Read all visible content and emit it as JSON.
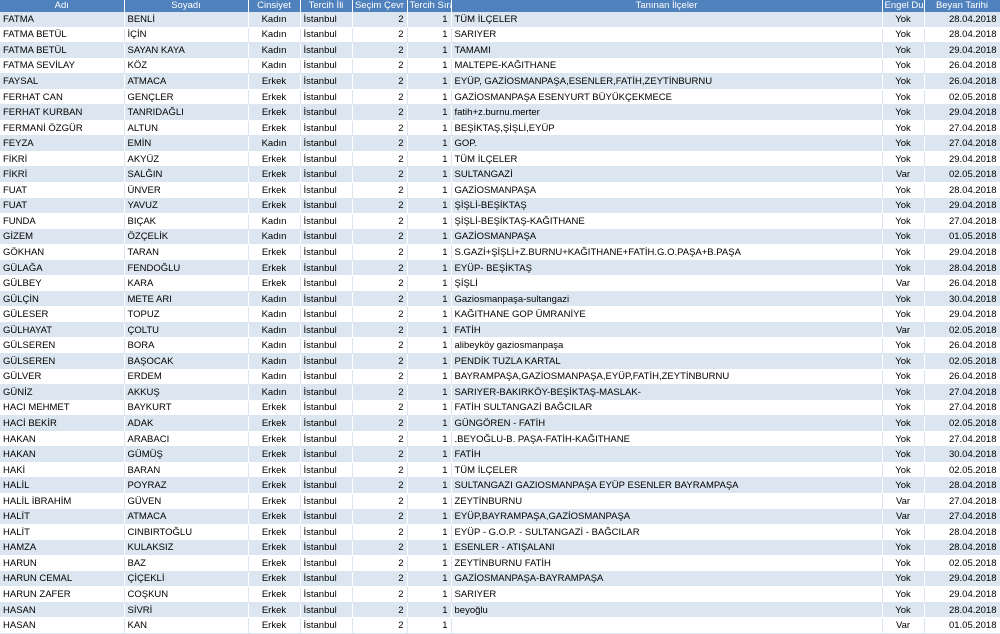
{
  "headers": [
    "Adı",
    "Soyadı",
    "Cinsiyet",
    "Tercih İli",
    "Seçim Çevr",
    "Tercih Sıra",
    "Tanınan İlçeler",
    "Engel Du",
    "Beyan Tarihi"
  ],
  "rows": [
    [
      "FATMA",
      "BENLİ",
      "Kadın",
      "İstanbul",
      "2",
      "1",
      "TÜM İLÇELER",
      "Yok",
      "28.04.2018"
    ],
    [
      "FATMA BETÜL",
      "İÇİN",
      "Kadın",
      "İstanbul",
      "2",
      "1",
      "SARIYER",
      "Yok",
      "28.04.2018"
    ],
    [
      "FATMA BETÜL",
      "SAYAN KAYA",
      "Kadın",
      "İstanbul",
      "2",
      "1",
      "TAMAMI",
      "Yok",
      "29.04.2018"
    ],
    [
      "FATMA SEVİLAY",
      "KÖZ",
      "Kadın",
      "İstanbul",
      "2",
      "1",
      "MALTEPE-KAĞITHANE",
      "Yok",
      "26.04.2018"
    ],
    [
      "FAYSAL",
      "ATMACA",
      "Erkek",
      "İstanbul",
      "2",
      "1",
      "EYÜP, GAZİOSMANPAŞA,ESENLER,FATİH,ZEYTİNBURNU",
      "Yok",
      "26.04.2018"
    ],
    [
      "FERHAT CAN",
      "GENÇLER",
      "Erkek",
      "İstanbul",
      "2",
      "1",
      "GAZİOSMANPAŞA ESENYURT BÜYÜKÇEKMECE",
      "Yok",
      "02.05.2018"
    ],
    [
      "FERHAT KURBAN",
      "TANRIDAĞLI",
      "Erkek",
      "İstanbul",
      "2",
      "1",
      "fatih+z.burnu.merter",
      "Yok",
      "29.04.2018"
    ],
    [
      "FERMANİ ÖZGÜR",
      "ALTUN",
      "Erkek",
      "İstanbul",
      "2",
      "1",
      "BEŞİKTAŞ,ŞİŞLİ,EYÜP",
      "Yok",
      "27.04.2018"
    ],
    [
      "FEYZA",
      "EMİN",
      "Kadın",
      "İstanbul",
      "2",
      "1",
      "GOP.",
      "Yok",
      "27.04.2018"
    ],
    [
      "FİKRİ",
      "AKYÜZ",
      "Erkek",
      "İstanbul",
      "2",
      "1",
      "TÜM İLÇELER",
      "Yok",
      "29.04.2018"
    ],
    [
      "FİKRİ",
      "SALĞIN",
      "Erkek",
      "İstanbul",
      "2",
      "1",
      "SULTANGAZİ",
      "Var",
      "02.05.2018"
    ],
    [
      "FUAT",
      "ÜNVER",
      "Erkek",
      "İstanbul",
      "2",
      "1",
      "GAZİOSMANPAŞA",
      "Yok",
      "28.04.2018"
    ],
    [
      "FUAT",
      "YAVUZ",
      "Erkek",
      "İstanbul",
      "2",
      "1",
      "ŞİŞLİ-BEŞİKTAŞ",
      "Yok",
      "29.04.2018"
    ],
    [
      "FUNDA",
      "BIÇAK",
      "Kadın",
      "İstanbul",
      "2",
      "1",
      "ŞİŞLİ-BEŞİKTAŞ-KAĞITHANE",
      "Yok",
      "27.04.2018"
    ],
    [
      "GİZEM",
      "ÖZÇELİK",
      "Kadın",
      "İstanbul",
      "2",
      "1",
      "GAZİOSMANPAŞA",
      "Yok",
      "01.05.2018"
    ],
    [
      "GÖKHAN",
      "TARAN",
      "Erkek",
      "İstanbul",
      "2",
      "1",
      "S.GAZİ+ŞİŞLİ+Z.BURNU+KAĞITHANE+FATİH.G.O.PAŞA+B.PAŞA",
      "Yok",
      "29.04.2018"
    ],
    [
      "GÜLAĞA",
      "FENDOĞLU",
      "Erkek",
      "İstanbul",
      "2",
      "1",
      "EYÜP- BEŞİKTAŞ",
      "Yok",
      "28.04.2018"
    ],
    [
      "GÜLBEY",
      "KARA",
      "Erkek",
      "İstanbul",
      "2",
      "1",
      "ŞİŞLİ",
      "Var",
      "26.04.2018"
    ],
    [
      "GÜLÇİN",
      "METE ARI",
      "Kadın",
      "İstanbul",
      "2",
      "1",
      "Gaziosmanpaşa-sultangazi",
      "Yok",
      "30.04.2018"
    ],
    [
      "GÜLESER",
      "TOPUZ",
      "Kadın",
      "İstanbul",
      "2",
      "1",
      "KAĞITHANE GOP ÜMRANİYE",
      "Yok",
      "29.04.2018"
    ],
    [
      "GÜLHAYAT",
      "ÇOLTU",
      "Kadın",
      "İstanbul",
      "2",
      "1",
      "FATİH",
      "Var",
      "02.05.2018"
    ],
    [
      "GÜLSEREN",
      "BORA",
      "Kadın",
      "İstanbul",
      "2",
      "1",
      "alibeyköy gaziosmanpaşa",
      "Yok",
      "26.04.2018"
    ],
    [
      "GÜLSEREN",
      "BAŞOCAK",
      "Kadın",
      "İstanbul",
      "2",
      "1",
      "PENDİK TUZLA KARTAL",
      "Yok",
      "02.05.2018"
    ],
    [
      "GÜLVER",
      "ERDEM",
      "Kadın",
      "İstanbul",
      "2",
      "1",
      "BAYRAMPAŞA,GAZİOSMANPAŞA,EYÜP,FATİH,ZEYTİNBURNU",
      "Yok",
      "26.04.2018"
    ],
    [
      "GÜNİZ",
      "AKKUŞ",
      "Kadın",
      "İstanbul",
      "2",
      "1",
      "SARIYER-BAKIRKÖY-BEŞİKTAŞ-MASLAK-",
      "Yok",
      "27.04.2018"
    ],
    [
      "HACI MEHMET",
      "BAYKURT",
      "Erkek",
      "İstanbul",
      "2",
      "1",
      "FATİH SULTANGAZİ BAĞCILAR",
      "Yok",
      "27.04.2018"
    ],
    [
      "HACİ BEKİR",
      "ADAK",
      "Erkek",
      "İstanbul",
      "2",
      "1",
      "GÜNGÖREN - FATİH",
      "Yok",
      "02.05.2018"
    ],
    [
      "HAKAN",
      "ARABACI",
      "Erkek",
      "İstanbul",
      "2",
      "1",
      ".BEYOĞLU-B. PAŞA-FATİH-KAĞITHANE",
      "Yok",
      "27.04.2018"
    ],
    [
      "HAKAN",
      "GÜMÜŞ",
      "Erkek",
      "İstanbul",
      "2",
      "1",
      "FATİH",
      "Yok",
      "30.04.2018"
    ],
    [
      "HAKİ",
      "BARAN",
      "Erkek",
      "İstanbul",
      "2",
      "1",
      "TÜM İLÇELER",
      "Yok",
      "02.05.2018"
    ],
    [
      "HALİL",
      "POYRAZ",
      "Erkek",
      "İstanbul",
      "2",
      "1",
      "SULTANGAZI GAZIOSMANPAŞA EYÜP ESENLER BAYRAMPAŞA",
      "Yok",
      "28.04.2018"
    ],
    [
      "HALİL İBRAHİM",
      "GÜVEN",
      "Erkek",
      "İstanbul",
      "2",
      "1",
      "ZEYTİNBURNU",
      "Var",
      "27.04.2018"
    ],
    [
      "HALİT",
      "ATMACA",
      "Erkek",
      "İstanbul",
      "2",
      "1",
      "EYÜP,BAYRAMPAŞA,GAZİOSMANPAŞA",
      "Var",
      "27.04.2018"
    ],
    [
      "HALİT",
      "CINBIRTOĞLU",
      "Erkek",
      "İstanbul",
      "2",
      "1",
      "EYÜP - G.O.P. - SULTANGAZİ - BAĞCILAR",
      "Yok",
      "28.04.2018"
    ],
    [
      "HAMZA",
      "KULAKSIZ",
      "Erkek",
      "İstanbul",
      "2",
      "1",
      "ESENLER - ATIŞALANI",
      "Yok",
      "28.04.2018"
    ],
    [
      "HARUN",
      "BAZ",
      "Erkek",
      "İstanbul",
      "2",
      "1",
      "ZEYTİNBURNU FATİH",
      "Yok",
      "02.05.2018"
    ],
    [
      "HARUN CEMAL",
      "ÇİÇEKLİ",
      "Erkek",
      "İstanbul",
      "2",
      "1",
      "GAZİOSMANPAŞA-BAYRAMPAŞA",
      "Yok",
      "29.04.2018"
    ],
    [
      "HARUN ZAFER",
      "COŞKUN",
      "Erkek",
      "İstanbul",
      "2",
      "1",
      "SARIYER",
      "Yok",
      "29.04.2018"
    ],
    [
      "HASAN",
      "SİVRİ",
      "Erkek",
      "İstanbul",
      "2",
      "1",
      "beyoğlu",
      "Yok",
      "28.04.2018"
    ],
    [
      "HASAN",
      "KAN",
      "Erkek",
      "İstanbul",
      "2",
      "1",
      "",
      "Var",
      "01.05.2018"
    ]
  ]
}
